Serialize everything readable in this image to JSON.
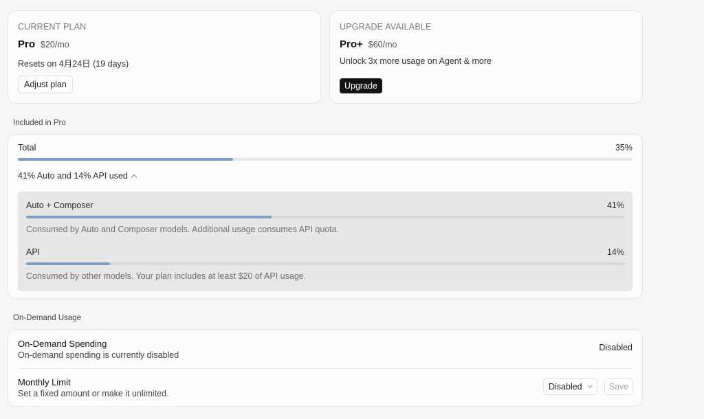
{
  "current_plan": {
    "kicker": "CURRENT PLAN",
    "name": "Pro",
    "price": "$20/mo",
    "reset_text": "Resets on 4月24日 (19 days)",
    "button_label": "Adjust plan"
  },
  "upgrade": {
    "kicker": "UPGRADE AVAILABLE",
    "name": "Pro+",
    "price": "$60/mo",
    "description": "Unlock 3x more usage on Agent & more",
    "button_label": "Upgrade"
  },
  "included": {
    "section_label": "Included in Pro",
    "total": {
      "label": "Total",
      "percent_text": "35%",
      "fraction": 0.35
    },
    "toggle_label": "41% Auto and 14% API used",
    "breakdown": [
      {
        "label": "Auto + Composer",
        "percent_text": "41%",
        "fraction": 0.41,
        "description": "Consumed by Auto and Composer models. Additional usage consumes API quota."
      },
      {
        "label": "API",
        "percent_text": "14%",
        "fraction": 0.14,
        "description": "Consumed by other models. Your plan includes at least $20 of API usage."
      }
    ]
  },
  "on_demand": {
    "section_label": "On-Demand Usage",
    "spending": {
      "title": "On-Demand Spending",
      "subtitle": "On-demand spending is currently disabled",
      "status": "Disabled"
    },
    "limit": {
      "title": "Monthly Limit",
      "subtitle": "Set a fixed amount or make it unlimited.",
      "select_value": "Disabled",
      "save_label": "Save"
    }
  },
  "colors": {
    "bar_fill": "#7c9fc1",
    "bar_track": "#e3e7ec",
    "upgrade_button": "#141414"
  }
}
